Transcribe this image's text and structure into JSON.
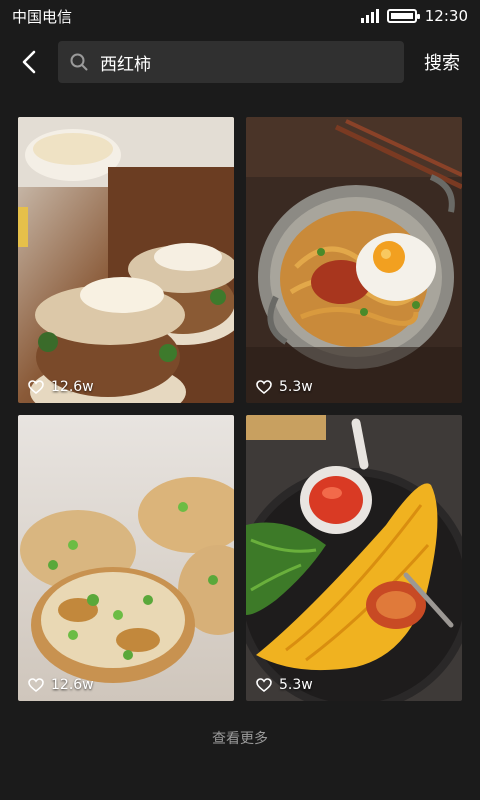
{
  "status": {
    "carrier": "中国电信",
    "time": "12:30"
  },
  "header": {
    "search_value": "西红柿",
    "search_button": "搜索"
  },
  "recipes": [
    {
      "likes": "12.6w",
      "image": "burger-buns-photo"
    },
    {
      "likes": "5.3w",
      "image": "noodles-fried-egg-photo"
    },
    {
      "likes": "12.6w",
      "image": "potato-cakes-photo"
    },
    {
      "likes": "5.3w",
      "image": "omelette-rice-photo"
    }
  ],
  "footer": {
    "more_label": "查看更多"
  }
}
